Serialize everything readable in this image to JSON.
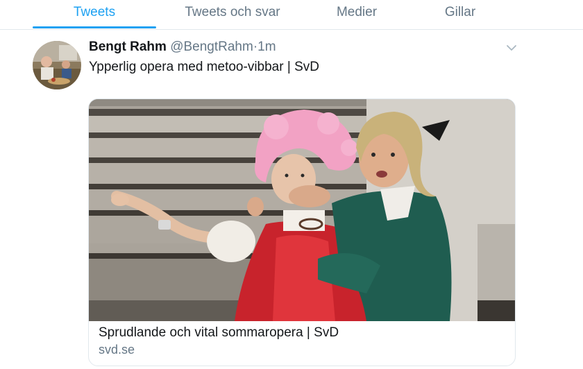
{
  "tabs": [
    {
      "label": "Tweets",
      "active": true
    },
    {
      "label": "Tweets och svar",
      "active": false
    },
    {
      "label": "Medier",
      "active": false
    },
    {
      "label": "Gillar",
      "active": false
    }
  ],
  "tweet": {
    "author_name": "Bengt Rahm",
    "handle": "@BengtRahm",
    "separator": "·",
    "time": "1m",
    "text": "Ypperlig opera med metoo-vibbar | SvD",
    "card": {
      "title": "Sprudlande och vital sommaropera | SvD",
      "domain": "svd.se"
    }
  },
  "colors": {
    "accent": "#1da1f2",
    "text": "#14171a",
    "secondary": "#657786",
    "border": "#e1e8ed"
  },
  "icons": {
    "menu": "chevron-down-icon"
  }
}
